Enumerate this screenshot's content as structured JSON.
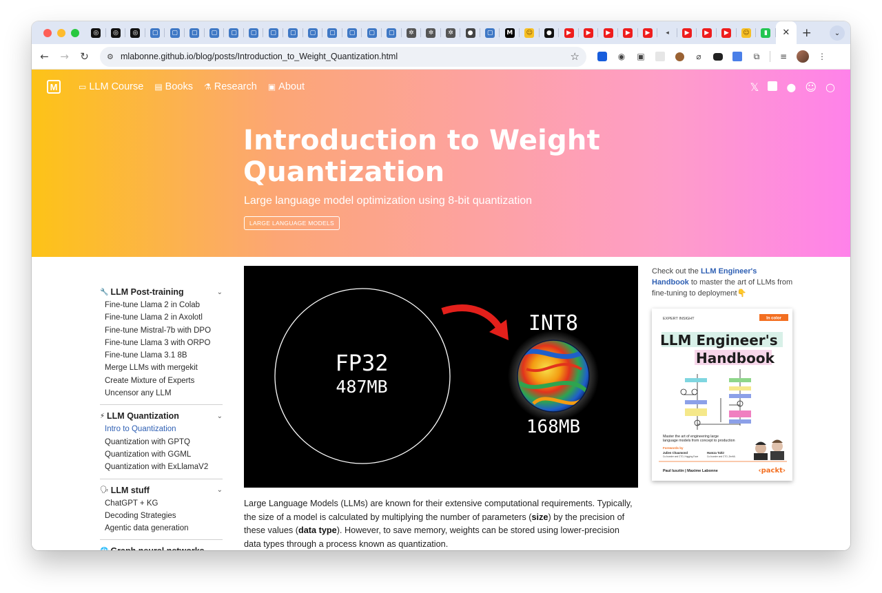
{
  "browser": {
    "tab_icons": [
      "openai-icon",
      "openai-icon",
      "openai-icon",
      "notebook-icon",
      "notebook-icon",
      "notebook-icon",
      "notebook-icon",
      "notebook-icon",
      "notebook-icon",
      "notebook-icon",
      "notebook-icon",
      "notebook-icon",
      "notebook-icon",
      "notebook-icon",
      "notebook-icon",
      "notebook-icon",
      "gear-icon",
      "gear-icon",
      "gear-icon",
      "globe-icon",
      "notebook-icon",
      "medium-icon",
      "hugging-face-icon",
      "github-icon",
      "youtube-icon",
      "youtube-icon",
      "youtube-icon",
      "youtube-icon",
      "youtube-icon",
      "speaker-icon",
      "youtube-icon",
      "youtube-icon",
      "youtube-icon",
      "hugging-face-icon",
      "book-icon"
    ],
    "active_tab_close": "✕",
    "new_tab": "+",
    "url": "mlabonne.github.io/blog/posts/Introduction_to_Weight_Quantization.html"
  },
  "nav": {
    "logo": "M",
    "links": [
      {
        "icon": "laptop-icon",
        "glyph": "▭",
        "label": "LLM Course"
      },
      {
        "icon": "book-icon",
        "glyph": "▤",
        "label": "Books"
      },
      {
        "icon": "flask-icon",
        "glyph": "⚗",
        "label": "Research"
      },
      {
        "icon": "id-card-icon",
        "glyph": "▣",
        "label": "About"
      }
    ]
  },
  "hero": {
    "title": "Introduction to Weight Quantization",
    "subtitle": "Large language model optimization using 8-bit quantization",
    "tag": "LARGE LANGUAGE MODELS"
  },
  "sidebar": {
    "sections": [
      {
        "emoji": "🔧",
        "title": "LLM Post-training",
        "items": [
          "Fine-tune Llama 2 in Colab",
          "Fine-tune Llama 2 in Axolotl",
          "Fine-tune Mistral-7b with DPO",
          "Fine-tune Llama 3 with ORPO",
          "Fine-tune Llama 3.1 8B",
          "Merge LLMs with mergekit",
          "Create Mixture of Experts",
          "Uncensor any LLM"
        ]
      },
      {
        "emoji": "⚡",
        "title": "LLM Quantization",
        "items": [
          "Intro to Quantization",
          "Quantization with GPTQ",
          "Quantization with GGML",
          "Quantization with ExLlamaV2"
        ],
        "active_index": 0
      },
      {
        "emoji": "🗣",
        "title": "LLM stuff",
        "items": [
          "ChatGPT + KG",
          "Decoding Strategies",
          "Agentic data generation"
        ]
      },
      {
        "emoji": "🌐",
        "title": "Graph neural networks",
        "items": []
      }
    ]
  },
  "figure": {
    "left_label": "FP32",
    "left_size": "487MB",
    "right_label": "INT8",
    "right_size": "168MB"
  },
  "article": {
    "p1_a": "Large Language Models (LLMs) are known for their extensive computational requirements. Typically, the size of a model is calculated by multiplying the number of parameters (",
    "p1_b": "size",
    "p1_c": ") by the precision of these values (",
    "p1_d": "data type",
    "p1_e": "). However, to save memory, weights can be stored using lower-precision data types through a process known as quantization."
  },
  "aside": {
    "text_before": "Check out the ",
    "link": "LLM Engineer's Handbook",
    "text_after": " to master the art of LLMs from fine-tuning to deployment👇",
    "book": {
      "series": "EXPERT INSIGHT",
      "badge": "In color",
      "title_line1": "LLM Engineer's",
      "title_line2": "Handbook",
      "tagline": "Master the art of engineering large language models from concept to production",
      "forewords_label": "Forewords by",
      "foreword1_name": "Julien Chaumond",
      "foreword1_role": "Co-founder and CTO, Hugging Face",
      "foreword2_name": "Hamza Tahir",
      "foreword2_role": "Co-founder and CTO, ZenML",
      "authors": "Paul Iusztin | Maxime Labonne",
      "publisher": "‹packt›"
    }
  },
  "colors": {
    "hero_gradient": [
      "#fdc317",
      "#fca675",
      "#fda2a2",
      "#fe9dc9",
      "#ff82ea"
    ],
    "link": "#2e5fb3",
    "arrow_red": "#e3201b"
  }
}
